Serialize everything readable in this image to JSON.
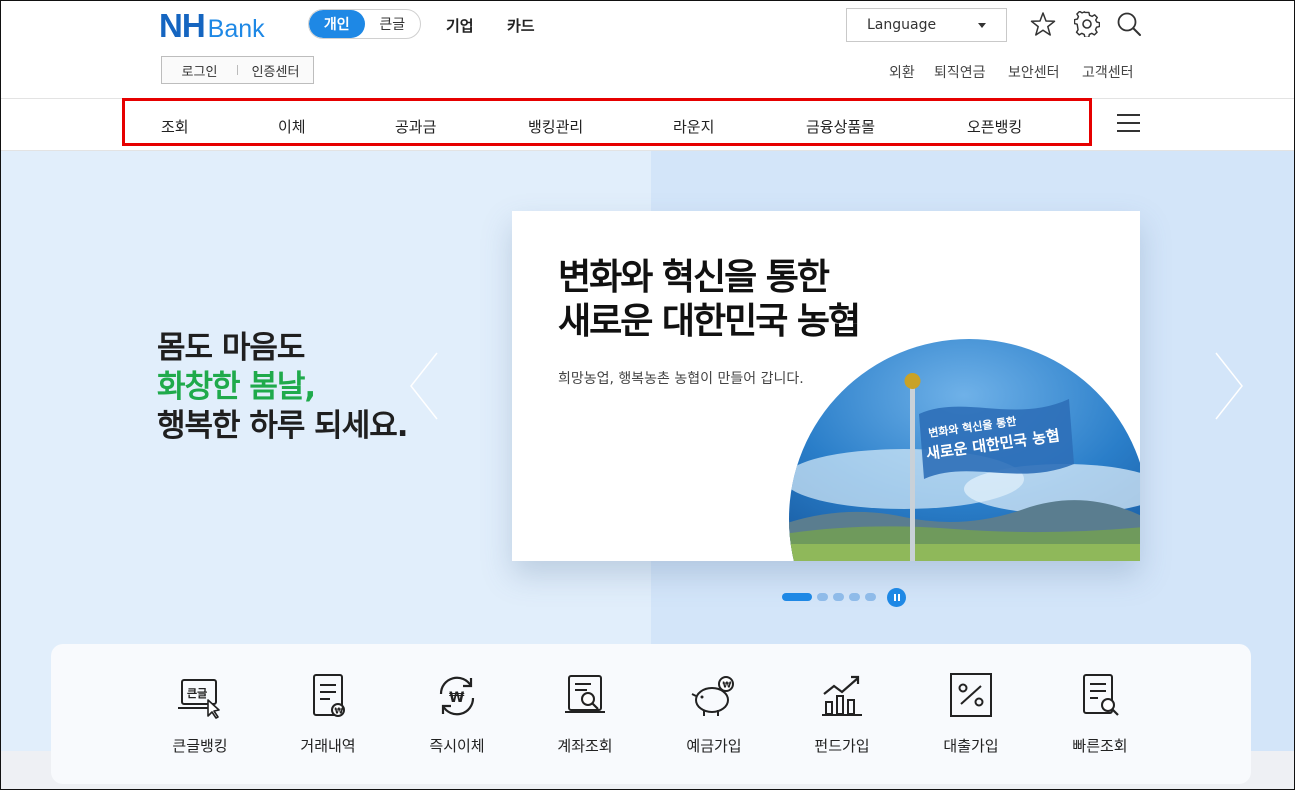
{
  "header": {
    "logo_nh": "NH",
    "logo_bank": "Bank",
    "segment": {
      "personal": "개인",
      "large_text": "큰글"
    },
    "links": {
      "business": "기업",
      "card": "카드"
    },
    "language": "Language",
    "login": "로그인",
    "cert_center": "인증센터",
    "util_links": [
      "외환",
      "퇴직연금",
      "보안센터",
      "고객센터"
    ]
  },
  "gnb": {
    "items": [
      "조회",
      "이체",
      "공과금",
      "뱅킹관리",
      "라운지",
      "금융상품몰",
      "오픈뱅킹"
    ]
  },
  "hero": {
    "slogan_line1": "몸도 마음도",
    "slogan_line2": "화창한 봄날,",
    "slogan_line3": "행복한 하루 되세요.",
    "card_title_line1": "변화와 혁신을 통한",
    "card_title_line2": "새로운 대한민국 농협",
    "card_subtitle": "희망농업, 행복농촌 농협이 만들어 갑니다.",
    "flag_text_line1": "변화와 혁신을 통한",
    "flag_text_line2": "새로운 대한민국 농협",
    "slide_count": 5,
    "active_slide": 1
  },
  "quick_menu": {
    "items": [
      "큰글뱅킹",
      "거래내역",
      "즉시이체",
      "계좌조회",
      "예금가입",
      "펀드가입",
      "대출가입",
      "빠른조회"
    ]
  },
  "colors": {
    "brand_blue": "#1e88e5",
    "slogan_green": "#1faa4b",
    "highlight_red": "#e60000"
  }
}
